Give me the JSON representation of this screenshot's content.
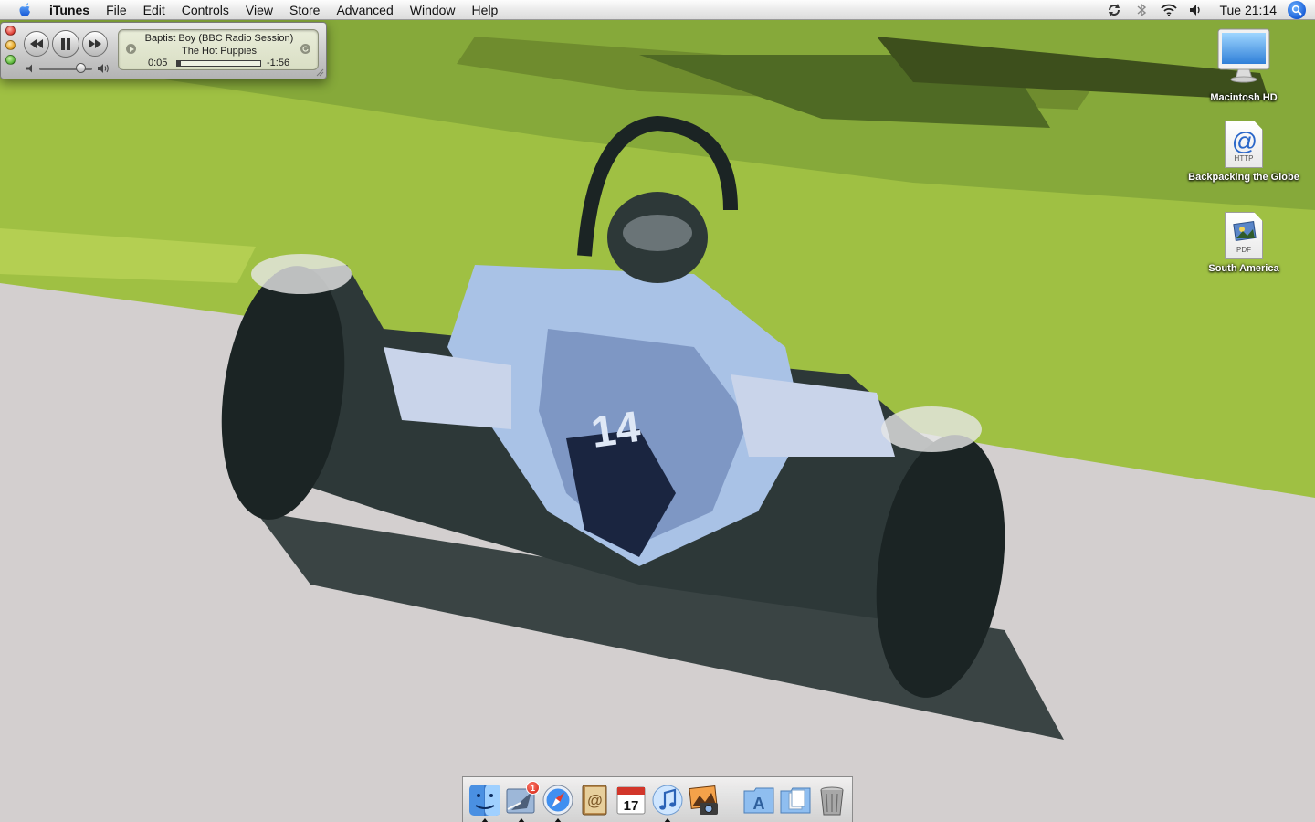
{
  "menubar": {
    "apple_icon": "apple-icon",
    "app_name": "iTunes",
    "items": [
      "File",
      "Edit",
      "Controls",
      "View",
      "Store",
      "Advanced",
      "Window",
      "Help"
    ],
    "status_icons": [
      "sync-icon",
      "bluetooth-icon",
      "wifi-icon",
      "volume-icon"
    ],
    "clock": "Tue 21:14",
    "spotlight_icon": "spotlight-icon"
  },
  "miniplayer": {
    "track_title": "Baptist Boy (BBC Radio Session)",
    "artist": "The Hot Puppies",
    "elapsed": "0:05",
    "remaining": "-1:56",
    "progress": 0.04,
    "volume": 0.85
  },
  "desktop_icons": [
    {
      "label": "Macintosh HD",
      "icon": "hard-drive-icon"
    },
    {
      "label": "Backpacking the Globe",
      "icon": "http-document-icon",
      "tag": "HTTP"
    },
    {
      "label": "South America",
      "icon": "pdf-document-icon",
      "tag": "PDF"
    }
  ],
  "dock": {
    "items": [
      {
        "name": "Finder",
        "icon": "finder-icon",
        "running": true
      },
      {
        "name": "Mail",
        "icon": "mail-icon",
        "running": true,
        "badge": "1"
      },
      {
        "name": "Safari",
        "icon": "safari-icon",
        "running": true
      },
      {
        "name": "Address Book",
        "icon": "address-book-icon",
        "running": false
      },
      {
        "name": "iCal",
        "icon": "ical-icon",
        "running": false,
        "date": "17"
      },
      {
        "name": "iTunes",
        "icon": "itunes-icon",
        "running": true
      },
      {
        "name": "iPhoto",
        "icon": "iphoto-icon",
        "running": false
      },
      {
        "name": "Applications",
        "icon": "applications-folder-icon",
        "running": false
      },
      {
        "name": "Documents",
        "icon": "documents-folder-icon",
        "running": false
      },
      {
        "name": "Trash",
        "icon": "trash-icon",
        "running": false
      }
    ]
  },
  "colors": {
    "grass": "#9fc043",
    "road": "#d3cfcf",
    "car_blue": "#a9c2e6"
  }
}
